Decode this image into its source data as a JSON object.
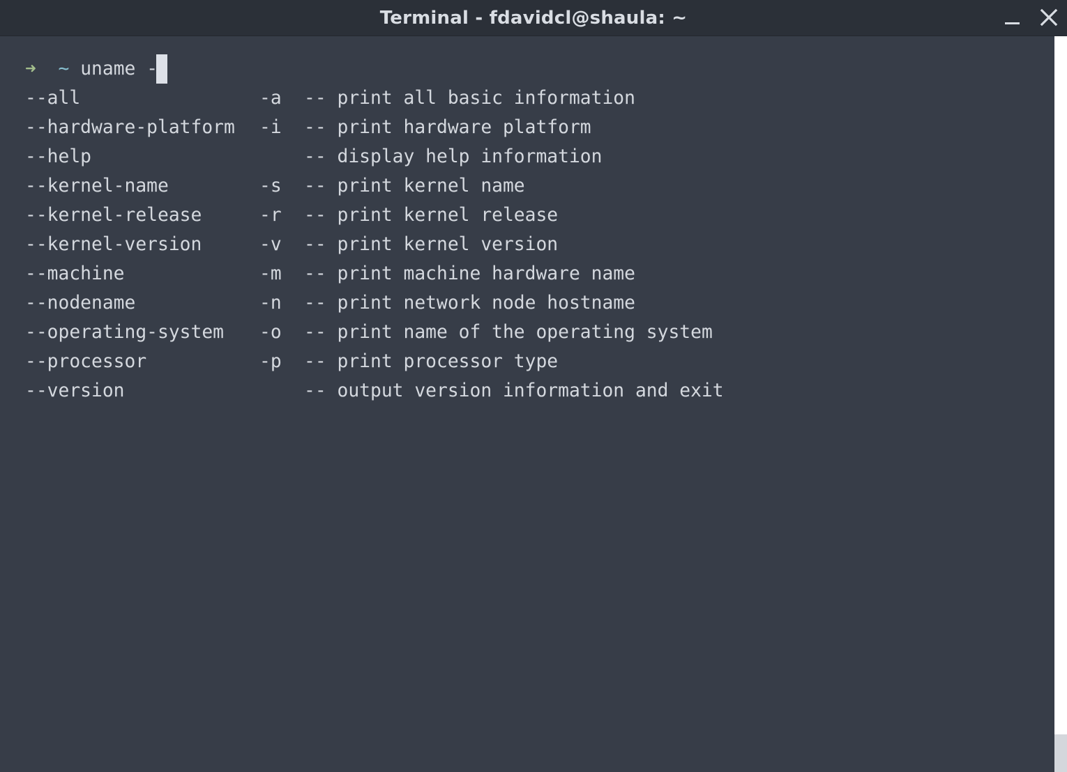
{
  "window": {
    "title": "Terminal - fdavidcl@shaula: ~"
  },
  "prompt": {
    "arrow": "➜",
    "cwd": "~",
    "command": "uname -"
  },
  "completions": [
    {
      "long": "--all",
      "short": "-a",
      "desc": "-- print all basic information"
    },
    {
      "long": "--hardware-platform",
      "short": "-i",
      "desc": "-- print hardware platform"
    },
    {
      "long": "--help",
      "short": "",
      "desc": "-- display help information"
    },
    {
      "long": "--kernel-name",
      "short": "-s",
      "desc": "-- print kernel name"
    },
    {
      "long": "--kernel-release",
      "short": "-r",
      "desc": "-- print kernel release"
    },
    {
      "long": "--kernel-version",
      "short": "-v",
      "desc": "-- print kernel version"
    },
    {
      "long": "--machine",
      "short": "-m",
      "desc": "-- print machine hardware name"
    },
    {
      "long": "--nodename",
      "short": "-n",
      "desc": "-- print network node hostname"
    },
    {
      "long": "--operating-system",
      "short": "-o",
      "desc": "-- print name of the operating system"
    },
    {
      "long": "--processor",
      "short": "-p",
      "desc": "-- print processor type"
    },
    {
      "long": "--version",
      "short": "",
      "desc": "-- output version information and exit"
    }
  ],
  "colors": {
    "background": "#373d48",
    "titlebar": "#2b3038",
    "foreground": "#d4d8de",
    "prompt_arrow": "#a3be8c",
    "prompt_cwd": "#88c0d0",
    "cursor": "#dde1e8"
  },
  "icons": {
    "minimize": "minimize-icon",
    "close": "close-icon"
  }
}
